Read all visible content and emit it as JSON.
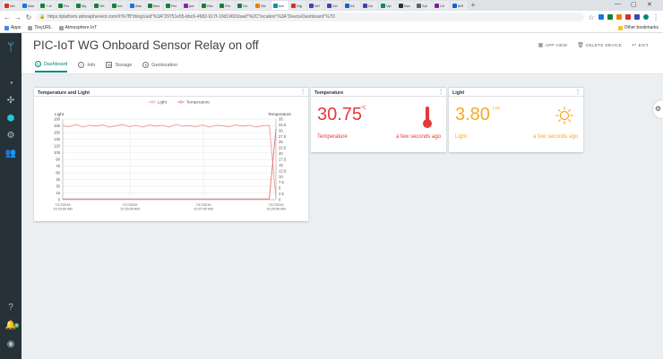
{
  "browser": {
    "tabs": [
      "Inb",
      "Atm",
      "+ el",
      "Per",
      "My",
      "OK",
      "Inh",
      "Atm",
      "Ben",
      "Per",
      "per",
      "Rev",
      "Per",
      "Go",
      "Sle",
      "Am",
      "Dig",
      "NH",
      "Zel",
      "Kil",
      "De",
      "Vyt",
      "Nov",
      "Sol",
      "Ch",
      "8/R"
    ],
    "tab_colors": [
      "#d93025",
      "#1a73e8",
      "#188038",
      "#188038",
      "#188038",
      "#188038",
      "#188038",
      "#1a73e8",
      "#188038",
      "#188038",
      "#8e24aa",
      "#188038",
      "#188038",
      "#188038",
      "#f57c00",
      "#0097a7",
      "#d93025",
      "#3949ab",
      "#3949ab",
      "#1565c0",
      "#3949ab",
      "#00897b",
      "#263238",
      "#616161",
      "#7b1fa2",
      "#1565c0"
    ],
    "new_tab": "+",
    "url_scheme": "https://",
    "url": "https://platform.atmosphereiot.com/#!%7B\"thingUuid\"%3A\"29751e55-bbc6-4982-917f-10d19601baef\"%2C\"location\"%3A\"DeviceDashboard\"%7D",
    "bookmarks": [
      "Apps",
      "TinyURL",
      "Atmosphere IoT"
    ],
    "other_bookmarks": "Other bookmarks",
    "controls": [
      "—",
      "▢",
      "✕"
    ]
  },
  "header": {
    "title": "PIC-IoT WG Onboard Sensor Relay on off",
    "actions": [
      {
        "label": "APP VIEW",
        "icon": "app-view-icon"
      },
      {
        "label": "DELETE DEVICE",
        "icon": "trash-icon"
      },
      {
        "label": "EXIT",
        "icon": "exit-icon"
      }
    ],
    "tabs": [
      {
        "label": "Dashboard",
        "icon": "dashboard-icon"
      },
      {
        "label": "Info",
        "icon": "info-icon"
      },
      {
        "label": "Storage",
        "icon": "storage-icon"
      },
      {
        "label": "Geolocation",
        "icon": "geolocation-icon"
      }
    ]
  },
  "sidebar": {
    "icons": [
      "logo-icon",
      "speedometer-icon",
      "connections-icon",
      "cube-icon",
      "gear-icon",
      "users-icon",
      "help-icon",
      "bell-icon",
      "account-icon"
    ],
    "notification_count": "1"
  },
  "cards": {
    "chart": {
      "title": "Temperature and Light",
      "menu": "⋮"
    },
    "temperature": {
      "title": "Temperature",
      "value": "30.75",
      "unit": "°C",
      "label": "Temperature",
      "time": "a few seconds ago",
      "color": "#e53935",
      "icon": "thermometer-icon",
      "menu": "⋮"
    },
    "light": {
      "title": "Light",
      "value": "3.80",
      "unit": "Lux",
      "label": "Light",
      "time": "a few seconds ago",
      "color": "#f9a825",
      "icon": "sun-icon",
      "menu": "⋮"
    }
  },
  "chart_data": {
    "type": "line",
    "legend": [
      "Light",
      "Temperature"
    ],
    "legend_position": "top-center",
    "y_left": {
      "label": "Light",
      "ticks": [
        0,
        15,
        30,
        45,
        60,
        75,
        90,
        105,
        120,
        135,
        150,
        165,
        180
      ],
      "ylim": [
        0,
        180
      ]
    },
    "y_right": {
      "label": "Temperature",
      "ticks": [
        0,
        2.5,
        5,
        7.5,
        10,
        12.5,
        15,
        17.5,
        20,
        22.5,
        25,
        27.5,
        30,
        32.5,
        35
      ],
      "ylim": [
        0,
        35
      ]
    },
    "x_ticks": [
      "7/17/2019 10:23:00 AM",
      "7/17/2019 10:25:00 AM",
      "7/17/2019 10:27:00 AM",
      "7/17/2019 10:29:00 AM"
    ],
    "grid": true,
    "series": [
      {
        "name": "Light",
        "color": "#ef9a9a",
        "values": [
          165,
          163,
          168,
          162,
          166,
          164,
          167,
          162,
          165,
          168,
          163,
          166,
          162,
          167,
          164,
          166,
          162,
          168,
          164,
          165,
          163,
          167,
          162,
          166,
          165,
          163,
          167,
          164,
          166,
          162,
          165,
          166,
          3.8
        ]
      },
      {
        "name": "Temperature",
        "color": "#e57373",
        "values": [
          0.3,
          0.3,
          0.3,
          0.3,
          0.3,
          0.3,
          0.3,
          0.3,
          0.3,
          0.3,
          0.3,
          0.3,
          0.3,
          0.3,
          0.3,
          0.3,
          0.3,
          0.3,
          0.3,
          0.3,
          0.3,
          0.3,
          0.3,
          0.3,
          0.3,
          0.3,
          0.3,
          0.3,
          0.3,
          0.3,
          0.3,
          0.3,
          30.75
        ]
      }
    ]
  }
}
